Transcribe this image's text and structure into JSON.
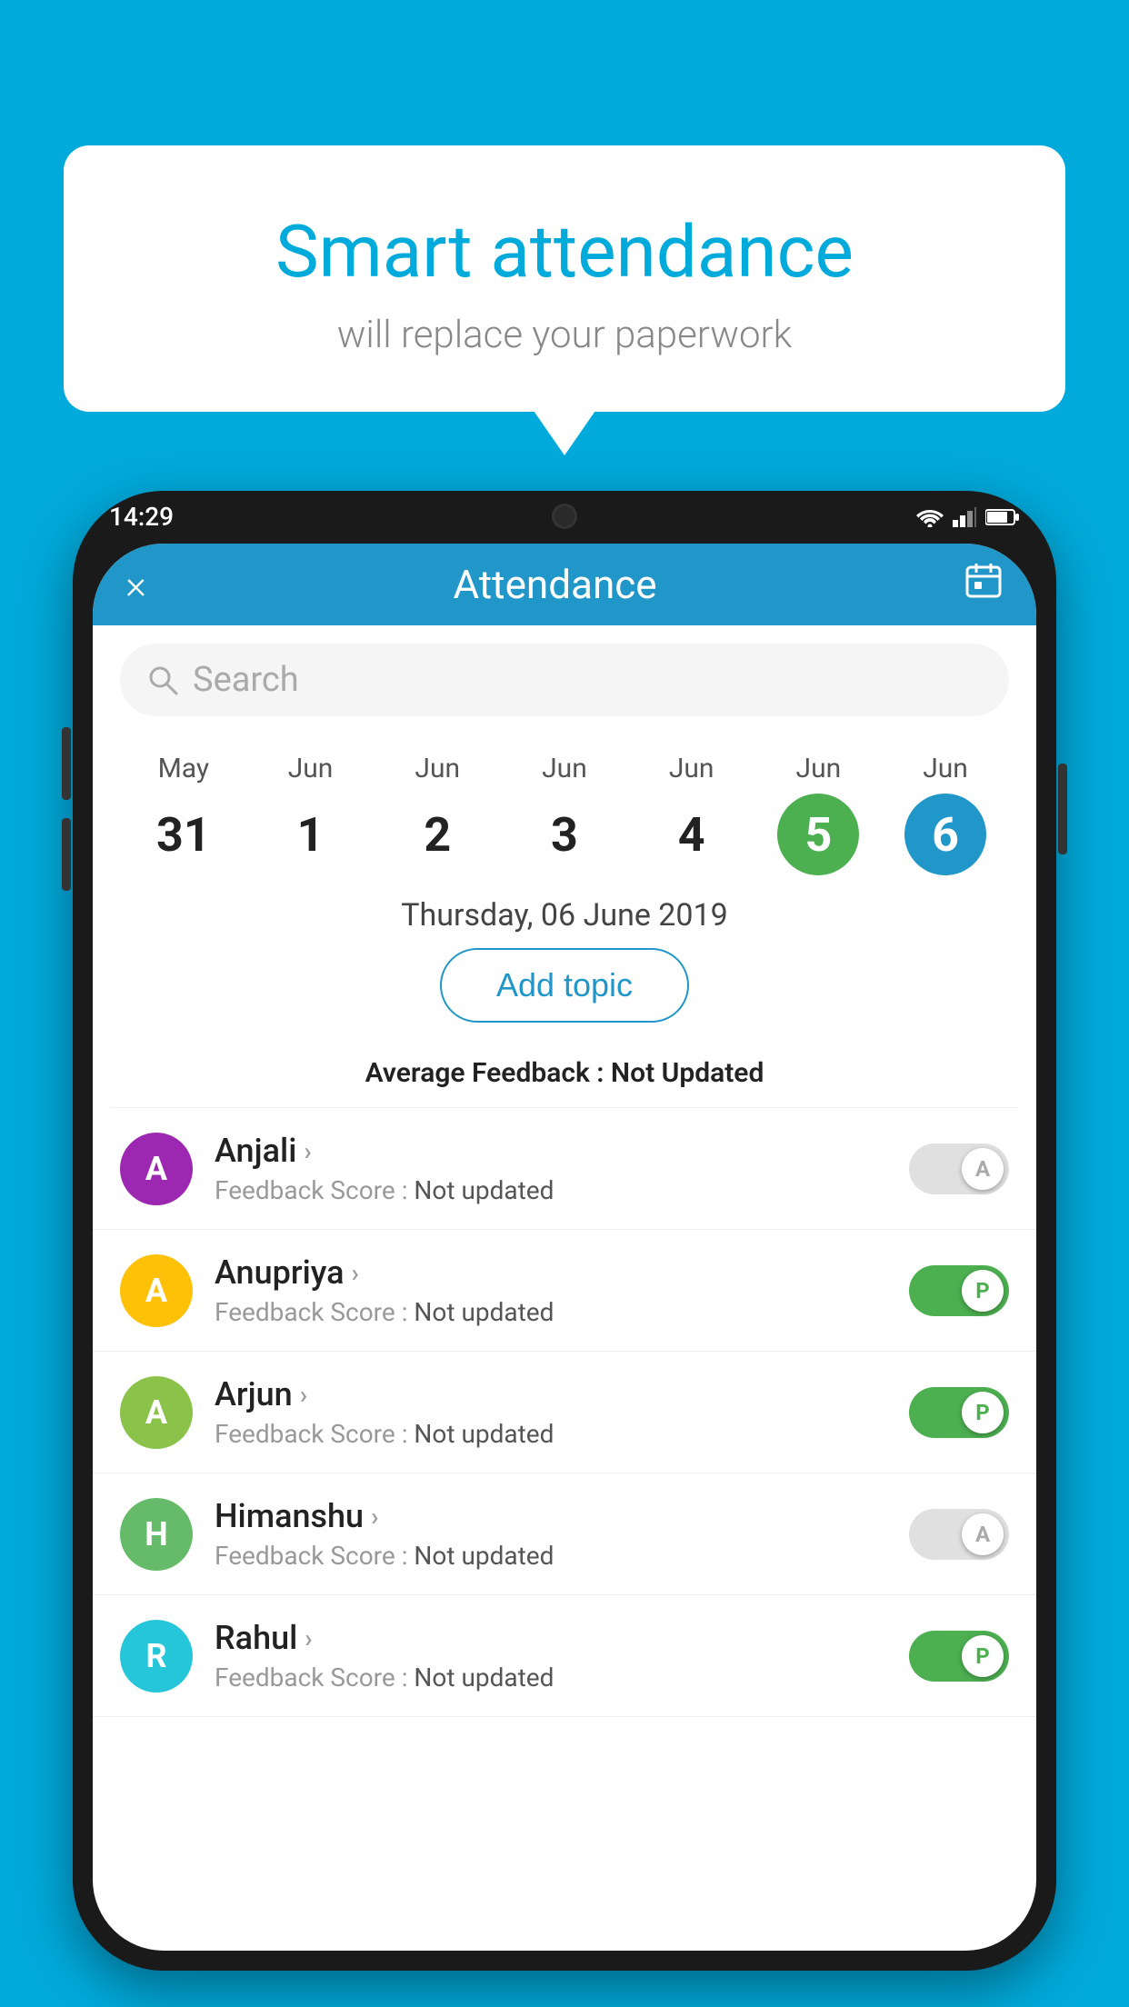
{
  "background_color": "#00AADB",
  "speech_bubble": {
    "title": "Smart attendance",
    "subtitle": "will replace your paperwork"
  },
  "status_bar": {
    "time": "14:29"
  },
  "header": {
    "title": "Attendance",
    "close_icon": "×",
    "calendar_icon": "📅"
  },
  "search": {
    "placeholder": "Search"
  },
  "calendar": {
    "days": [
      {
        "month": "May",
        "date": "31",
        "state": "normal"
      },
      {
        "month": "Jun",
        "date": "1",
        "state": "normal"
      },
      {
        "month": "Jun",
        "date": "2",
        "state": "normal"
      },
      {
        "month": "Jun",
        "date": "3",
        "state": "normal"
      },
      {
        "month": "Jun",
        "date": "4",
        "state": "normal"
      },
      {
        "month": "Jun",
        "date": "5",
        "state": "today"
      },
      {
        "month": "Jun",
        "date": "6",
        "state": "selected"
      }
    ]
  },
  "selected_date_label": "Thursday, 06 June 2019",
  "add_topic_label": "Add topic",
  "avg_feedback_label": "Average Feedback : ",
  "avg_feedback_value": "Not Updated",
  "students": [
    {
      "name": "Anjali",
      "avatar_letter": "A",
      "avatar_color": "#9C27B0",
      "score_label": "Feedback Score : ",
      "score_value": "Not updated",
      "toggle": "off",
      "toggle_label": "A"
    },
    {
      "name": "Anupriya",
      "avatar_letter": "A",
      "avatar_color": "#FFC107",
      "score_label": "Feedback Score : ",
      "score_value": "Not updated",
      "toggle": "on",
      "toggle_label": "P"
    },
    {
      "name": "Arjun",
      "avatar_letter": "A",
      "avatar_color": "#8BC34A",
      "score_label": "Feedback Score : ",
      "score_value": "Not updated",
      "toggle": "on",
      "toggle_label": "P"
    },
    {
      "name": "Himanshu",
      "avatar_letter": "H",
      "avatar_color": "#66BB6A",
      "score_label": "Feedback Score : ",
      "score_value": "Not updated",
      "toggle": "off",
      "toggle_label": "A"
    },
    {
      "name": "Rahul",
      "avatar_letter": "R",
      "avatar_color": "#26C6DA",
      "score_label": "Feedback Score : ",
      "score_value": "Not updated",
      "toggle": "on",
      "toggle_label": "P"
    }
  ]
}
